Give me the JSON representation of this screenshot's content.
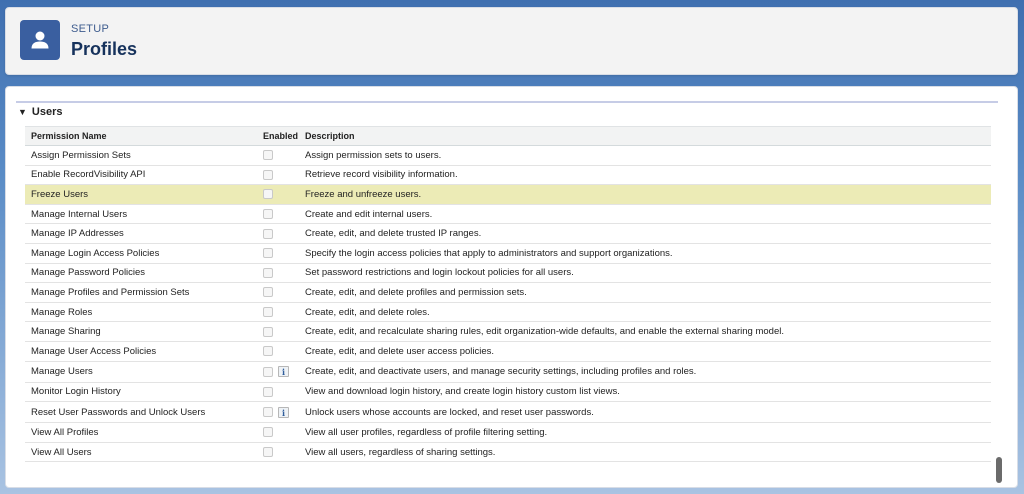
{
  "header": {
    "setup_label": "SETUP",
    "title": "Profiles",
    "icon": "user-icon"
  },
  "section": {
    "title": "Users",
    "collapse_icon": "triangle-down-icon"
  },
  "table": {
    "columns": [
      "Permission Name",
      "Enabled",
      "Description"
    ],
    "rows": [
      {
        "name": "Assign Permission Sets",
        "enabled": false,
        "info": false,
        "description": "Assign permission sets to users."
      },
      {
        "name": "Enable RecordVisibility API",
        "enabled": false,
        "info": false,
        "description": "Retrieve record visibility information."
      },
      {
        "name": "Freeze Users",
        "enabled": false,
        "info": false,
        "description": "Freeze and unfreeze users.",
        "highlighted": true
      },
      {
        "name": "Manage Internal Users",
        "enabled": false,
        "info": false,
        "description": "Create and edit internal users."
      },
      {
        "name": "Manage IP Addresses",
        "enabled": false,
        "info": false,
        "description": "Create, edit, and delete trusted IP ranges."
      },
      {
        "name": "Manage Login Access Policies",
        "enabled": false,
        "info": false,
        "description": "Specify the login access policies that apply to administrators and support organizations."
      },
      {
        "name": "Manage Password Policies",
        "enabled": false,
        "info": false,
        "description": "Set password restrictions and login lockout policies for all users."
      },
      {
        "name": "Manage Profiles and Permission Sets",
        "enabled": false,
        "info": false,
        "description": "Create, edit, and delete profiles and permission sets."
      },
      {
        "name": "Manage Roles",
        "enabled": false,
        "info": false,
        "description": "Create, edit, and delete roles."
      },
      {
        "name": "Manage Sharing",
        "enabled": false,
        "info": false,
        "description": "Create, edit, and recalculate sharing rules, edit organization-wide defaults, and enable the external sharing model."
      },
      {
        "name": "Manage User Access Policies",
        "enabled": false,
        "info": false,
        "description": "Create, edit, and delete user access policies."
      },
      {
        "name": "Manage Users",
        "enabled": false,
        "info": true,
        "description": "Create, edit, and deactivate users, and manage security settings, including profiles and roles."
      },
      {
        "name": "Monitor Login History",
        "enabled": false,
        "info": false,
        "description": "View and download login history, and create login history custom list views."
      },
      {
        "name": "Reset User Passwords and Unlock Users",
        "enabled": false,
        "info": true,
        "description": "Unlock users whose accounts are locked, and reset user passwords."
      },
      {
        "name": "View All Profiles",
        "enabled": false,
        "info": false,
        "description": "View all user profiles, regardless of profile filtering setting."
      },
      {
        "name": "View All Users",
        "enabled": false,
        "info": false,
        "description": "View all users, regardless of sharing settings."
      }
    ]
  },
  "info_icon_glyph": "i",
  "colors": {
    "highlight_row": "#ecebb6",
    "header_icon_bg": "#3a5fa0",
    "title": "#16325c"
  }
}
